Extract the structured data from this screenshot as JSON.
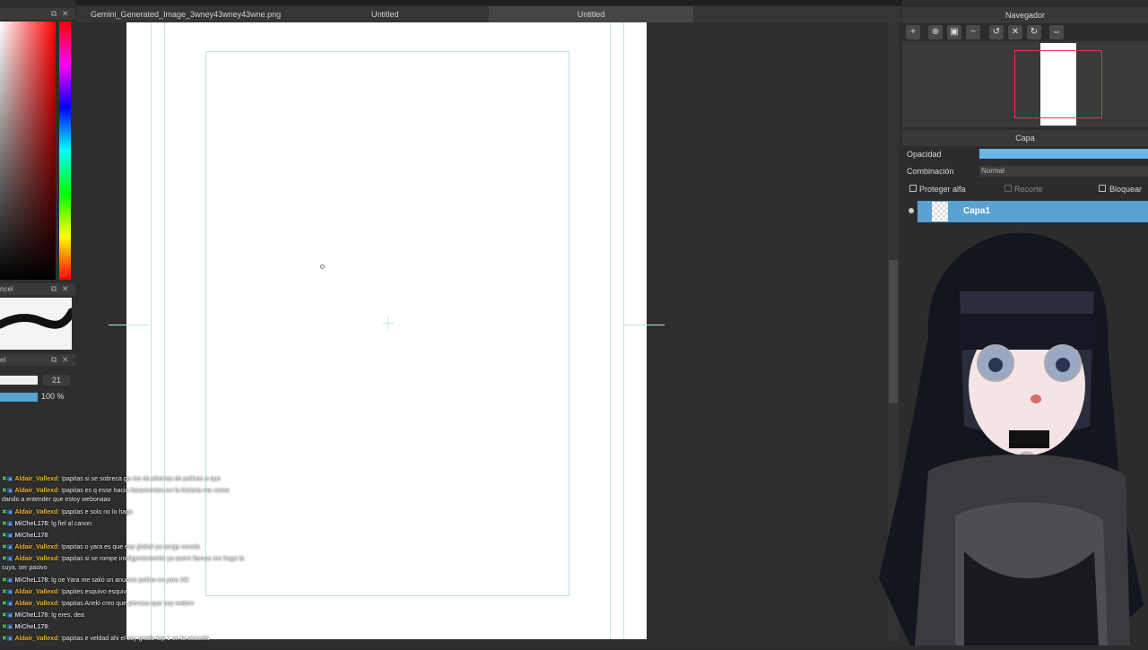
{
  "tabs": [
    {
      "label": "Gemini_Generated_Image_3wney43wney43wne.png",
      "active": false
    },
    {
      "label": "Untitled",
      "active": false
    },
    {
      "label": "Untitled",
      "active": true
    }
  ],
  "left_panels": {
    "brush_panel_title": "ncel",
    "brush_size_panel_title": "el",
    "brush_size_value": "21",
    "brush_opacity_value": "100 %"
  },
  "navigator": {
    "title": "Navegador",
    "buttons": [
      "zoom-in-icon",
      "zoom-in-icon",
      "fit-icon",
      "zoom-out-icon",
      "rotate-left-icon",
      "reset-icon",
      "rotate-right-icon",
      "flip-icon"
    ]
  },
  "layer_panel": {
    "title": "Capa",
    "opacity_label": "Opacidad",
    "blend_label": "Combinación",
    "blend_value": "Normal",
    "protect_alpha_label": "Proteger alfa",
    "clipping_label": "Recorte",
    "lock_label": "Bloquear",
    "layers": [
      {
        "name": "Capa1",
        "selected": true
      }
    ]
  },
  "chat": [
    {
      "user": "Aldair_Vallexd",
      "color": "gold",
      "text": ": !papitas si se sobreca ga me da ahorras de polinas a que"
    },
    {
      "user": "Aldair_Vallexd",
      "color": "gold",
      "text": ": !papitas es q esse hacia Ilavamentos en la historia me como"
    },
    {
      "user": "",
      "color": "gold",
      "text": "dando a entender que estoy webonaao"
    },
    {
      "user": "Aldair_Vallexd",
      "color": "gold",
      "text": ": !papitas e solo no lo hago"
    },
    {
      "user": "MiCheL178",
      "color": "silver",
      "text": ": lg fiel al canon"
    },
    {
      "user": "MiCheL178",
      "color": "silver",
      "text": ""
    },
    {
      "user": "Aldair_Vallexd",
      "color": "gold",
      "text": ": !papitas o yara es que esp global ya rangp novela"
    },
    {
      "user": "Aldair_Vallexd",
      "color": "gold",
      "text": ": !papitas si se rompe inteligentemente ya quere llamas me hago la"
    },
    {
      "user": "",
      "color": "gold",
      "text": "suya, ser pasivo"
    },
    {
      "user": "MiCheL178",
      "color": "silver",
      "text": ": lg oe Yara me salió un anuncio polina no yara XD"
    },
    {
      "user": "Aldair_Vallexd",
      "color": "gold",
      "text": ": !papites esquivo esquiv"
    },
    {
      "user": "Aldair_Vallexd",
      "color": "gold",
      "text": ": !papitas Aneki creo que piensas que soy webon"
    },
    {
      "user": "MiCheL178",
      "color": "silver",
      "text": ": lg eres, dea"
    },
    {
      "user": "MiCheL178",
      "color": "silver",
      "text": ":"
    },
    {
      "user": "Aldair_Vallexd",
      "color": "gold",
      "text": ": !papitas e veldad ahi el soy grado top 1 en la escuela"
    }
  ],
  "colors": {
    "accent": "#5aa2d3",
    "opacity_bar": "#6bb6e6",
    "nav_frame": "#ff2a5a",
    "guide": "#bfe5e8",
    "chat_user_gold": "#f2b233"
  }
}
